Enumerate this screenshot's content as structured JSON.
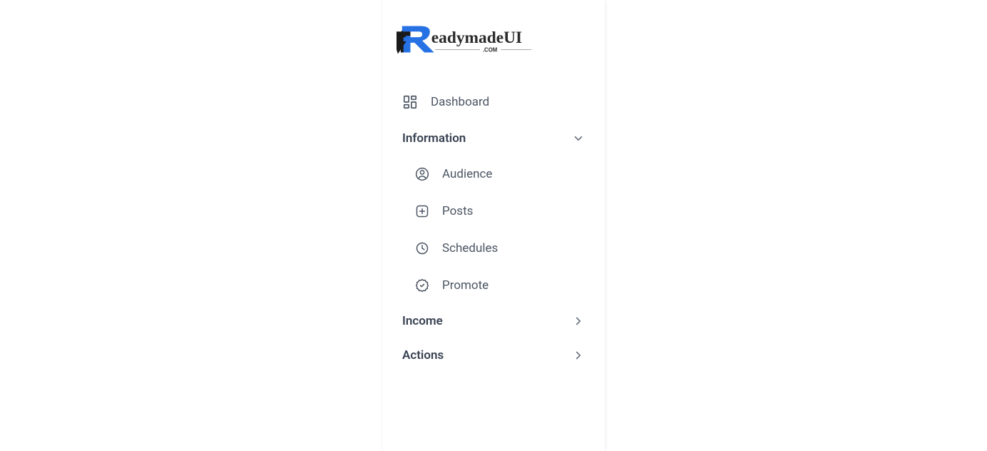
{
  "logo": {
    "text_main": "eadymadeUI",
    "text_sub": ".COM"
  },
  "nav": {
    "dashboard": "Dashboard"
  },
  "sections": {
    "information": {
      "title": "Information",
      "expanded": true,
      "items": {
        "audience": "Audience",
        "posts": "Posts",
        "schedules": "Schedules",
        "promote": "Promote"
      }
    },
    "income": {
      "title": "Income",
      "expanded": false
    },
    "actions": {
      "title": "Actions",
      "expanded": false
    }
  }
}
